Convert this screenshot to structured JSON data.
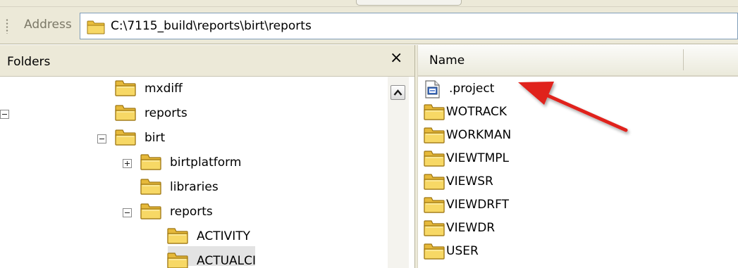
{
  "colors": {
    "chrome_bg": "#ece9d8",
    "folder_yellow": "#f2cf56",
    "arrow_red": "#e0201b"
  },
  "address": {
    "label": "Address",
    "value": "C:\\7115_build\\reports\\birt\\reports",
    "icon": "folder-icon"
  },
  "folders_pane": {
    "title": "Folders",
    "close_glyph": "×",
    "scroll_up_icon": "scroll-up-arrow-icon",
    "tree": [
      {
        "label": "mxdiff",
        "depth": 0,
        "expander": "none",
        "selected": false
      },
      {
        "label": "reports",
        "depth": 0,
        "expander": "minus",
        "selected": false
      },
      {
        "label": "birt",
        "depth": 1,
        "expander": "minus",
        "selected": false
      },
      {
        "label": "birtplatform",
        "depth": 2,
        "expander": "plus",
        "selected": false
      },
      {
        "label": "libraries",
        "depth": 2,
        "expander": "none",
        "selected": false
      },
      {
        "label": "reports",
        "depth": 2,
        "expander": "minus",
        "selected": true
      },
      {
        "label": "ACTIVITY",
        "depth": 3,
        "expander": "none",
        "selected": false
      },
      {
        "label": "ACTUALCI",
        "depth": 3,
        "expander": "none",
        "selected": false
      }
    ]
  },
  "files_pane": {
    "column_header": "Name",
    "items": [
      {
        "label": ".project",
        "type": "file",
        "icon": "project-file-icon"
      },
      {
        "label": "WOTRACK",
        "type": "folder",
        "icon": "folder-icon"
      },
      {
        "label": "WORKMAN",
        "type": "folder",
        "icon": "folder-icon"
      },
      {
        "label": "VIEWTMPL",
        "type": "folder",
        "icon": "folder-icon"
      },
      {
        "label": "VIEWSR",
        "type": "folder",
        "icon": "folder-icon"
      },
      {
        "label": "VIEWDRFT",
        "type": "folder",
        "icon": "folder-icon"
      },
      {
        "label": "VIEWDR",
        "type": "folder",
        "icon": "folder-icon"
      },
      {
        "label": "USER",
        "type": "folder",
        "icon": "folder-icon"
      }
    ]
  },
  "annotation": {
    "icon": "red-arrow-icon",
    "points_to": ".project"
  }
}
